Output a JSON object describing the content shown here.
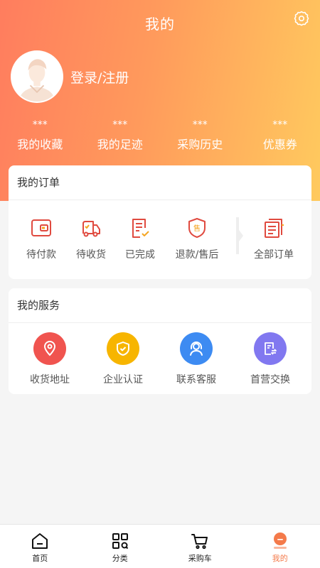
{
  "header": {
    "title": "我的",
    "login_label": "登录/注册"
  },
  "stats": [
    {
      "value": "***",
      "label": "我的收藏"
    },
    {
      "value": "***",
      "label": "我的足迹"
    },
    {
      "value": "***",
      "label": "采购历史"
    },
    {
      "value": "***",
      "label": "优惠券"
    }
  ],
  "orders": {
    "title": "我的订单",
    "items": [
      {
        "label": "待付款",
        "icon": "wallet-icon"
      },
      {
        "label": "待收货",
        "icon": "truck-icon"
      },
      {
        "label": "已完成",
        "icon": "completed-doc-icon"
      },
      {
        "label": "退款/售后",
        "icon": "after-sale-shield-icon"
      },
      {
        "label": "全部订单",
        "icon": "all-orders-icon"
      }
    ],
    "sale_char": "售"
  },
  "services": {
    "title": "我的服务",
    "items": [
      {
        "label": "收货地址",
        "icon": "location-pin-icon",
        "color": "#f0544f"
      },
      {
        "label": "企业认证",
        "icon": "shield-check-icon",
        "color": "#f7b500"
      },
      {
        "label": "联系客服",
        "icon": "customer-service-icon",
        "color": "#3d8bf2"
      },
      {
        "label": "首营交换",
        "icon": "exchange-doc-icon",
        "color": "#8178f0"
      }
    ]
  },
  "tabbar": [
    {
      "label": "首页",
      "icon": "home-icon"
    },
    {
      "label": "分类",
      "icon": "category-grid-icon"
    },
    {
      "label": "采购车",
      "icon": "cart-icon"
    },
    {
      "label": "我的",
      "icon": "profile-icon",
      "active": true
    }
  ],
  "colors": {
    "accent": "#f47a4a",
    "icon_red": "#e04a3f",
    "icon_orange": "#f5a623"
  }
}
